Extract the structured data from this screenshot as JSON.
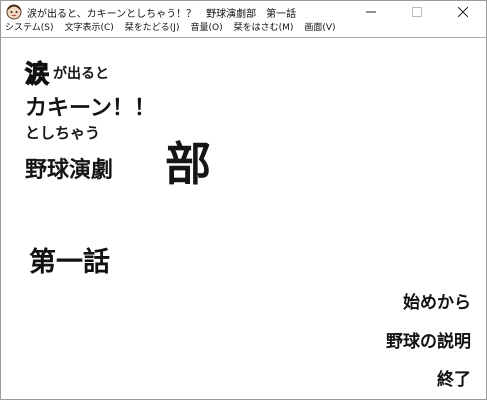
{
  "window": {
    "title": "涙が出ると、カキーンとしちゃう！？　野球演劇部　第一話",
    "icon": "app-character-icon",
    "controls": {
      "minimize": "minimize-icon",
      "maximize": "maximize-icon",
      "close": "close-icon"
    }
  },
  "menubar": {
    "items": [
      {
        "label": "システム(S)"
      },
      {
        "label": "文字表示(C)"
      },
      {
        "label": "栞をたどる(J)"
      },
      {
        "label": "音量(O)"
      },
      {
        "label": "栞をはさむ(M)"
      },
      {
        "label": "画面(V)"
      }
    ]
  },
  "logo": {
    "line1_kanji": "涙",
    "line1_rest": "が出ると",
    "line2": "カキーン！！",
    "line3": "としちゃう",
    "line4": "野球演劇",
    "line4_big": "部"
  },
  "episode": {
    "label": "第一話"
  },
  "start_menu": {
    "start": "始めから",
    "explain": "野球の説明",
    "quit": "終了"
  }
}
